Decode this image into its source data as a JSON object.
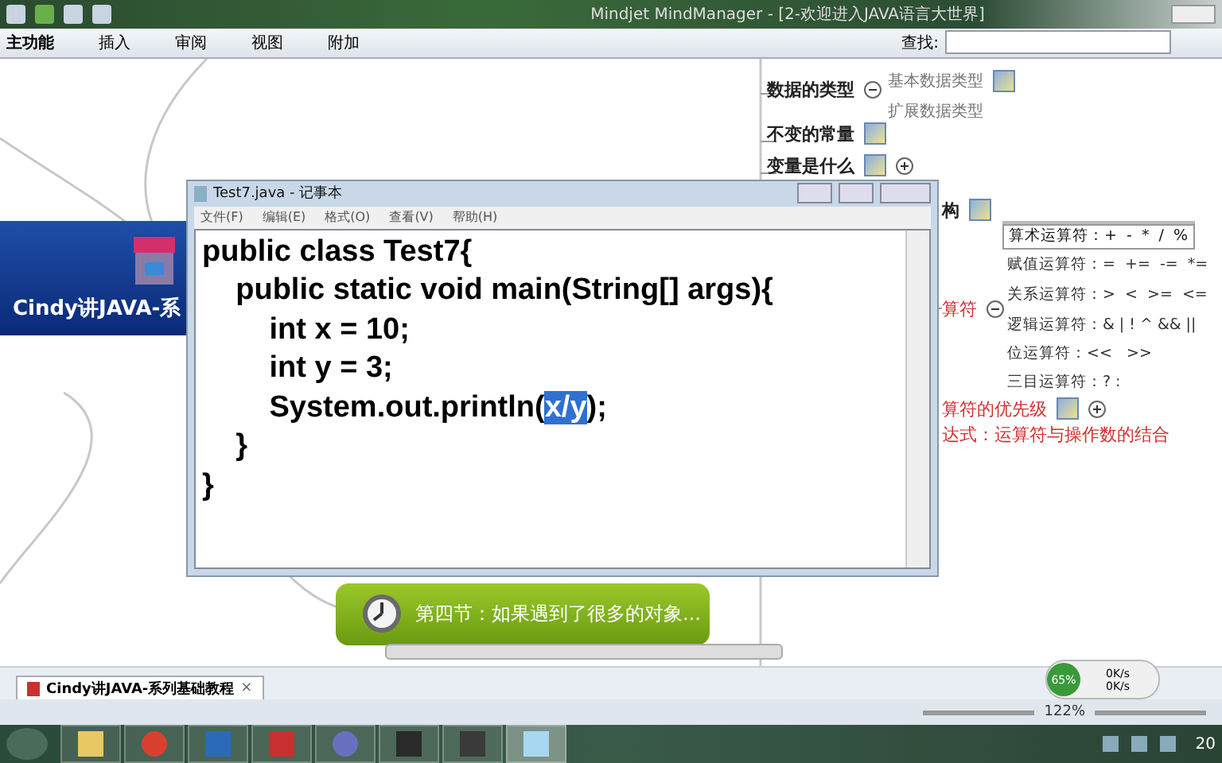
{
  "app_window": {
    "title": "Mindjet MindManager - [2-欢迎进入JAVA语言大世界]",
    "ribbon_tabs": [
      {
        "label": "主功能",
        "selected": true
      },
      {
        "label": "插入",
        "selected": false
      },
      {
        "label": "审阅",
        "selected": false
      },
      {
        "label": "视图",
        "selected": false
      },
      {
        "label": "附加",
        "selected": false
      }
    ],
    "search": {
      "label": "查找:"
    }
  },
  "mind_map": {
    "central_topic": "Cindy讲JAVA-系",
    "topics": [
      {
        "label": "数据的类型",
        "expanded": true,
        "has_note": false,
        "children": [
          {
            "label": "基本数据类型",
            "has_note": true
          },
          {
            "label": "扩展数据类型",
            "has_note": false
          }
        ]
      },
      {
        "label": "不变的常量",
        "has_note": true
      },
      {
        "label": "变量是什么",
        "has_note": true,
        "expanded": false
      },
      {
        "label": "构",
        "has_note": true
      },
      {
        "label": "算符",
        "red": true,
        "expanded": true,
        "children": [
          {
            "label": "算术运算符：+  -  *  /  %",
            "selected": true
          },
          {
            "label": "赋值运算符：=  +=  -=  *=",
            "selected": false
          },
          {
            "label": "关系运算符：>  <  >=  <=",
            "selected": false
          },
          {
            "label": "逻辑运算符：& | ! ^ && ||",
            "selected": false
          },
          {
            "label": "位运算符：<<   >>",
            "selected": false
          },
          {
            "label": "三目运算符：? :",
            "selected": false
          }
        ]
      },
      {
        "label": "算符的优先级",
        "red": true,
        "has_note": true,
        "expanded": false
      },
      {
        "label": "达式：运算符与操作数的结合",
        "red": true
      }
    ],
    "floating_topic": "第四节：如果遇到了很多的对象..."
  },
  "notepad": {
    "title": "Test7.java - 记事本",
    "menu": [
      "文件(F)",
      "编辑(E)",
      "格式(O)",
      "查看(V)",
      "帮助(H)"
    ],
    "lines": [
      {
        "segments": [
          {
            "text": "public class Test7{",
            "selected": false
          }
        ]
      },
      {
        "segments": [
          {
            "text": "    public static void main(String[] args){",
            "selected": false
          }
        ]
      },
      {
        "segments": [
          {
            "text": "        int x = 10;",
            "selected": false
          }
        ]
      },
      {
        "segments": [
          {
            "text": "        int y = 3;",
            "selected": false
          }
        ]
      },
      {
        "segments": [
          {
            "text": "        System.out.println(",
            "selected": false
          },
          {
            "text": "x/y",
            "selected": true
          },
          {
            "text": ");",
            "selected": false
          }
        ]
      },
      {
        "segments": [
          {
            "text": "    }",
            "selected": false
          }
        ]
      },
      {
        "segments": [
          {
            "text": "}",
            "selected": false
          }
        ]
      }
    ]
  },
  "document_tabs": [
    {
      "label": "Cindy讲JAVA-系列基础教程",
      "close": "×",
      "selected": true
    }
  ],
  "status_bar": {
    "zoom": "122%"
  },
  "network_meter": {
    "percent": "65%",
    "upload": "0K/s",
    "download": "0K/s"
  },
  "taskbar": {
    "clock": "20"
  }
}
